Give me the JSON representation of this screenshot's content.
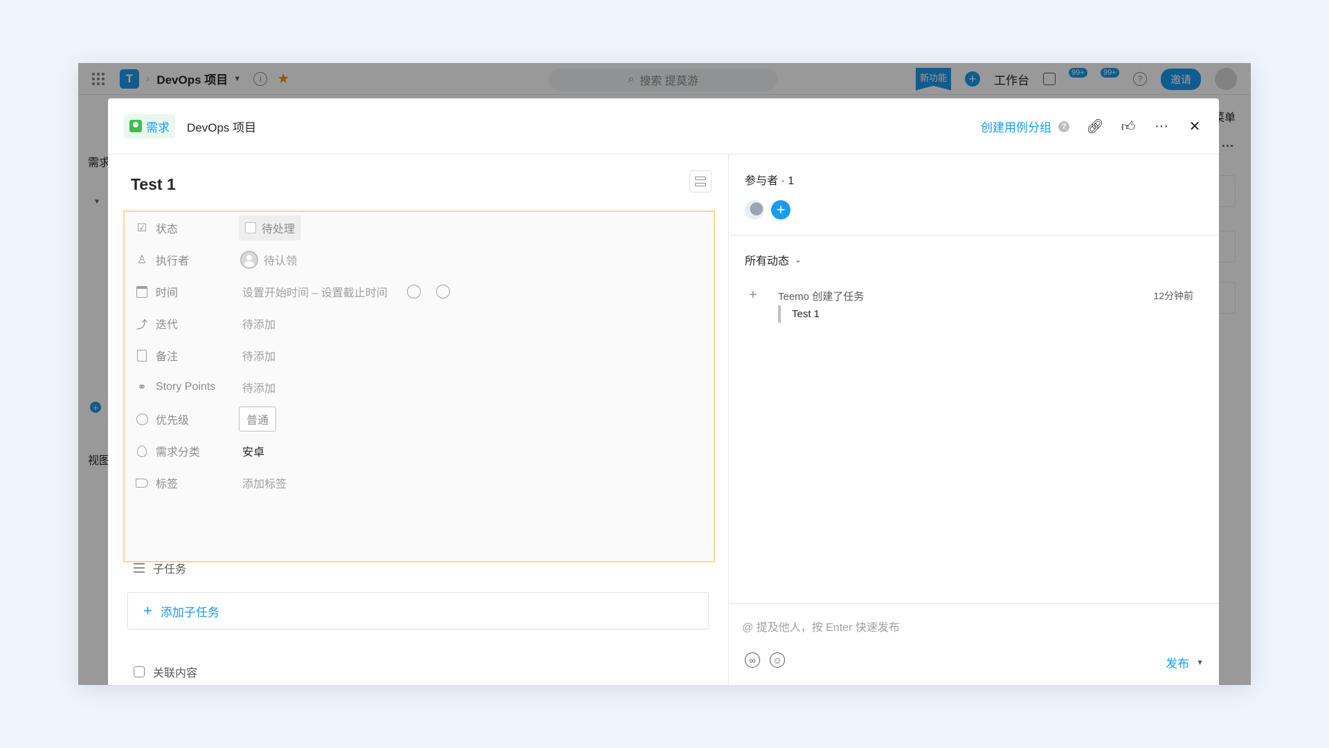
{
  "app": {
    "project_title": "DevOps 项目",
    "search_placeholder": "搜索 提莫游",
    "new_feature": "新功能",
    "workbench": "工作台",
    "badge_1": "99+",
    "badge_2": "99+",
    "invite": "邀请",
    "sidebar_label_1": "需求",
    "sidebar_label_2": "视图",
    "right_menu": "菜单"
  },
  "modal": {
    "type_label": "需求",
    "project_name": "DevOps 项目",
    "create_group": "创建用例分组",
    "task_title": "Test 1",
    "fields": [
      {
        "label": "状态",
        "value": "待处理"
      },
      {
        "label": "执行者",
        "value": "待认领"
      },
      {
        "label": "时间",
        "value": "设置开始时间 – 设置截止时间"
      },
      {
        "label": "迭代",
        "value": "待添加"
      },
      {
        "label": "备注",
        "value": "待添加"
      },
      {
        "label": "Story Points",
        "value": "待添加"
      },
      {
        "label": "优先级",
        "value": "普通"
      },
      {
        "label": "需求分类",
        "value": "安卓"
      },
      {
        "label": "标签",
        "value": "添加标签"
      }
    ],
    "subtasks_label": "子任务",
    "add_subtask": "添加子任务",
    "related_label": "关联内容"
  },
  "activity": {
    "participants": "参与者 · 1",
    "filter": "所有动态",
    "items": [
      {
        "text": "Teemo 创建了任务",
        "time": "12分钟前",
        "quote": "Test 1"
      }
    ]
  },
  "comment": {
    "placeholder": "@ 提及他人，按 Enter 快速发布",
    "publish": "发布"
  }
}
